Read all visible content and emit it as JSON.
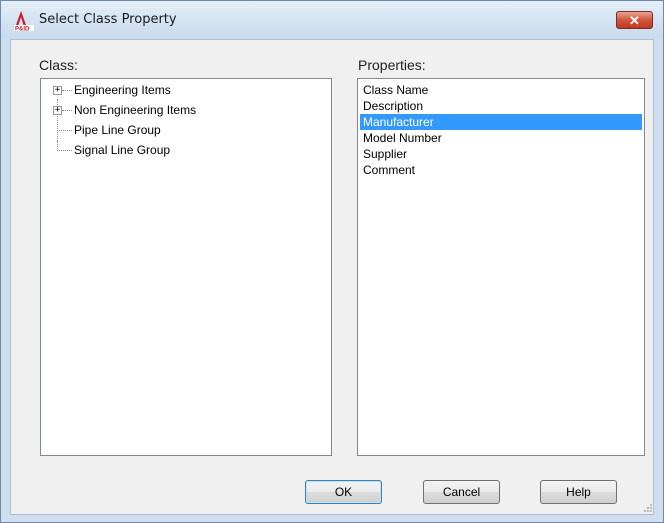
{
  "window": {
    "title": "Select Class Property",
    "icon": "autocad-pid-app-icon",
    "close_label": "✕"
  },
  "class_panel": {
    "label": "Class:",
    "tree": [
      {
        "label": "Engineering Items",
        "expandable": true,
        "expanded": false
      },
      {
        "label": "Non Engineering Items",
        "expandable": true,
        "expanded": false
      },
      {
        "label": "Pipe Line Group",
        "expandable": false
      },
      {
        "label": "Signal Line Group",
        "expandable": false
      }
    ],
    "expander_glyph": "+"
  },
  "properties_panel": {
    "label": "Properties:",
    "items": [
      "Class Name",
      "Description",
      "Manufacturer",
      "Model Number",
      "Supplier",
      "Comment"
    ],
    "selected": "Manufacturer",
    "selection_color": "#3399ff"
  },
  "buttons": {
    "ok": "OK",
    "cancel": "Cancel",
    "help": "Help"
  }
}
